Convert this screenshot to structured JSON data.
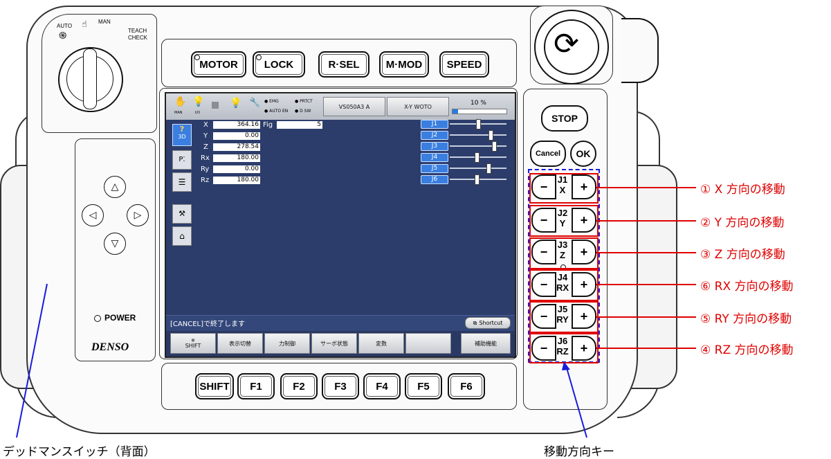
{
  "key_switch": {
    "auto": "AUTO",
    "man": "MAN",
    "teach": "TEACH",
    "check": "CHECK"
  },
  "top_buttons": [
    "MOTOR",
    "LOCK",
    "R·SEL",
    "M·MOD",
    "SPEED"
  ],
  "power_label": "POWER",
  "brand": "DENSO",
  "right_buttons": {
    "stop": "STOP",
    "cancel": "Cancel",
    "ok": "OK"
  },
  "bottom_buttons": [
    "SHIFT",
    "F1",
    "F2",
    "F3",
    "F4",
    "F5",
    "F6"
  ],
  "screen": {
    "status_icons": {
      "man": "MAN",
      "io": "I/O"
    },
    "indicators": [
      "EMG",
      "PRTCT",
      "AUTO EN",
      "D SW"
    ],
    "robot_button": "VS050A3 A",
    "mode_button": "X-Y WOTO",
    "speed_percent": "10 %",
    "speed_value": 10,
    "side_tab_3d": "3D",
    "coords": [
      {
        "label": "X",
        "value": "364.16"
      },
      {
        "label": "Y",
        "value": "0.00"
      },
      {
        "label": "Z",
        "value": "278.54"
      },
      {
        "label": "Rx",
        "value": "180.00"
      },
      {
        "label": "Ry",
        "value": "0.00"
      },
      {
        "label": "Rz",
        "value": "180.00"
      }
    ],
    "fig_label": "Fig",
    "fig_value": "5",
    "joints": [
      {
        "label": "J1",
        "level": 0.5
      },
      {
        "label": "J2",
        "level": 0.72
      },
      {
        "label": "J3",
        "level": 0.78
      },
      {
        "label": "J4",
        "level": 0.48
      },
      {
        "label": "J5",
        "level": 0.68
      },
      {
        "label": "J6",
        "level": 0.48
      }
    ],
    "message": "[CANCEL]で終了します",
    "shortcut": "Shortcut",
    "function_keys": [
      "SHIFT",
      "表示切替",
      "力制御",
      "サーボ状態",
      "変数",
      "",
      "補助機能"
    ]
  },
  "jog_keys": [
    {
      "joint": "J1",
      "axis": "X",
      "minus": "−",
      "plus": "+"
    },
    {
      "joint": "J2",
      "axis": "Y",
      "minus": "−",
      "plus": "+"
    },
    {
      "joint": "J3",
      "axis": "Z",
      "minus": "−",
      "plus": "+"
    },
    {
      "joint": "J4",
      "axis": "RX",
      "minus": "−",
      "plus": "+"
    },
    {
      "joint": "J5",
      "axis": "RY",
      "minus": "−",
      "plus": "+"
    },
    {
      "joint": "J6",
      "axis": "RZ",
      "minus": "−",
      "plus": "+"
    }
  ],
  "callouts": [
    "① X 方向の移動",
    "② Y 方向の移動",
    "③ Z 方向の移動",
    "⑥ RX 方向の移動",
    "⑤ RY 方向の移動",
    "④ RZ 方向の移動"
  ],
  "annotation_deadman": "デッドマンスイッチ（背面）",
  "annotation_jog": "移動方向キー",
  "colors": {
    "screen_bg": "#2c3d6b",
    "callout": "#e00000",
    "jog_box": "#1a1adc",
    "joint_tag": "#3a7fe0"
  }
}
